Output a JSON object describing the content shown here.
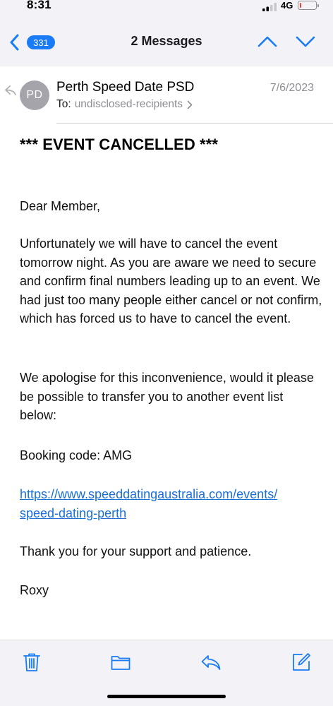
{
  "status_bar": {
    "time": "8:31",
    "network": "4G",
    "battery_level": 0.1,
    "battery_color": "#ff3b30"
  },
  "nav": {
    "unread_count": "331",
    "title": "2 Messages",
    "accent_color": "#1a7cf5",
    "icons": [
      "chevron-left-icon",
      "chevron-up-icon",
      "chevron-down-icon"
    ]
  },
  "message": {
    "avatar_initials": "PD",
    "sender": "Perth Speed Date PSD",
    "date": "7/6/2023",
    "to_label": "To:",
    "recipients": "undisclosed-recipients",
    "headline": "*** EVENT CANCELLED ***",
    "greeting": "Dear Member,",
    "paragraph_1": "Unfortunately we will have to cancel the event tomorrow night. As you are aware we need to secure and confirm final numbers leading up to an event.  We had just too many people either cancel or not confirm, which has forced us to have to cancel the event.",
    "paragraph_2": "We apologise for this inconvenience, would it please be possible to transfer you to another event list below:",
    "booking_code": "Booking code:  AMG",
    "link_line_1": "https://www.speeddatingaustralia.com/events/",
    "link_line_2": "speed-dating-perth",
    "thanks": "Thank you for your support and patience.",
    "signature": "Roxy",
    "link_color": "#1a6fd8"
  },
  "toolbar": {
    "icons": [
      "trash-icon",
      "folder-icon",
      "reply-icon",
      "compose-icon"
    ],
    "icon_color": "#1a7cf5"
  }
}
